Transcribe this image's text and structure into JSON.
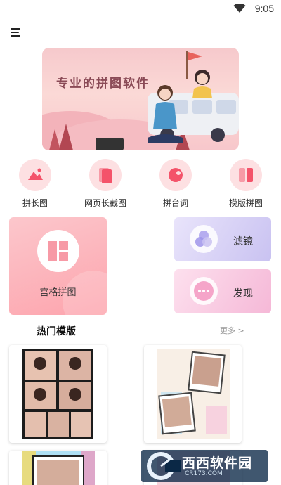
{
  "status_bar": {
    "time": "9:05",
    "icons": [
      "wifi-icon"
    ]
  },
  "header": {
    "menu_icon": "hamburger-menu-icon"
  },
  "banner": {
    "text": "专业的拼图软件"
  },
  "quick_actions": [
    {
      "label": "拼长图",
      "icon": "mountain-image-icon"
    },
    {
      "label": "网页长截图",
      "icon": "stacked-pages-icon"
    },
    {
      "label": "拼台词",
      "icon": "pie-dot-icon"
    },
    {
      "label": "模版拼图",
      "icon": "template-blocks-icon"
    }
  ],
  "feature_cards": {
    "grid": {
      "label": "宫格拼图",
      "icon": "grid-layout-icon"
    },
    "filter": {
      "label": "滤镜",
      "icon": "overlap-circles-icon"
    },
    "discover": {
      "label": "发现",
      "icon": "dots-icon"
    }
  },
  "hot_templates": {
    "title": "热门模版",
    "more": "更多 >"
  },
  "watermark": {
    "title": "西西软件园",
    "subtitle": "CR173.COM"
  },
  "colors": {
    "accent_pink": "#f4536a",
    "soft_pink": "#fde0e2",
    "lavender": "#c9c2f1"
  }
}
